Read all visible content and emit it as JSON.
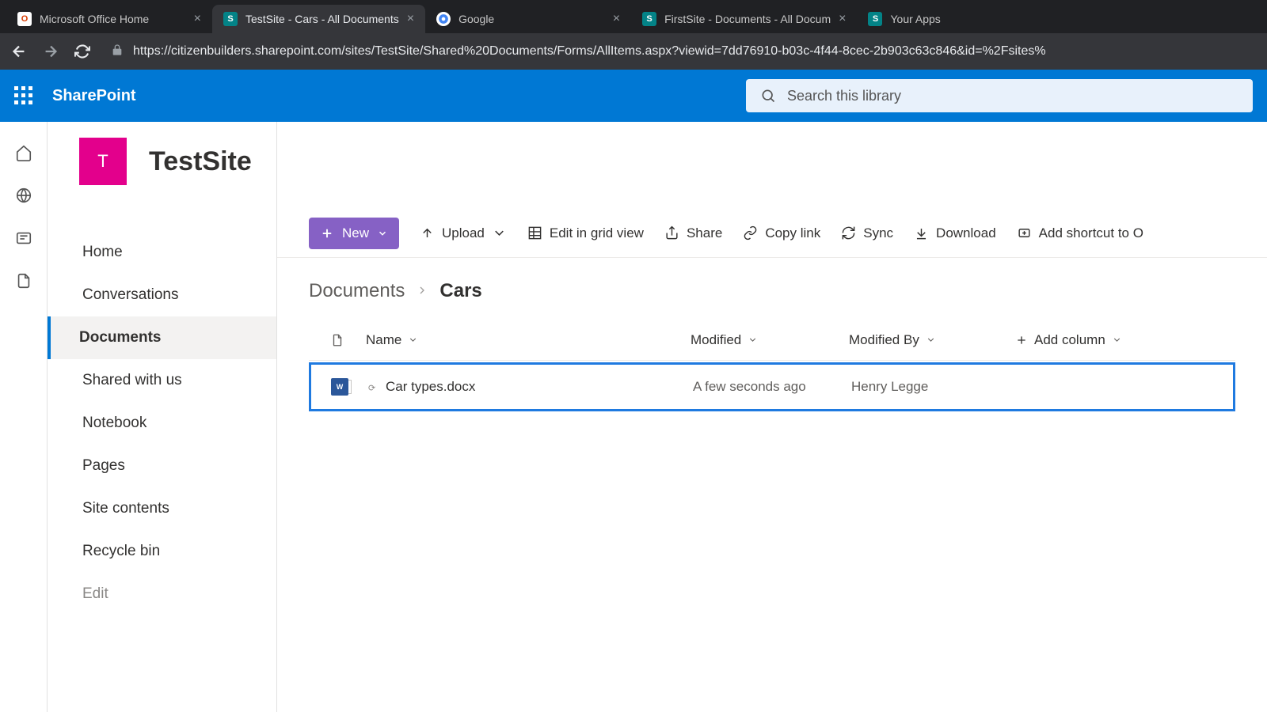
{
  "browser": {
    "tabs": [
      {
        "label": "Microsoft Office Home",
        "favicon": "office"
      },
      {
        "label": "TestSite - Cars - All Documents",
        "favicon": "sp",
        "active": true
      },
      {
        "label": "Google",
        "favicon": "google"
      },
      {
        "label": "FirstSite - Documents - All Docum",
        "favicon": "sp"
      },
      {
        "label": "Your Apps",
        "favicon": "sp"
      }
    ],
    "url": "https://citizenbuilders.sharepoint.com/sites/TestSite/Shared%20Documents/Forms/AllItems.aspx?viewid=7dd76910-b03c-4f44-8cec-2b903c63c846&id=%2Fsites%"
  },
  "suite": {
    "brand": "SharePoint",
    "search_placeholder": "Search this library"
  },
  "site": {
    "logo_letter": "T",
    "title": "TestSite"
  },
  "nav": {
    "items": [
      "Home",
      "Conversations",
      "Documents",
      "Shared with us",
      "Notebook",
      "Pages",
      "Site contents",
      "Recycle bin"
    ],
    "edit": "Edit",
    "active_index": 2
  },
  "commands": {
    "new": "New",
    "upload": "Upload",
    "edit_grid": "Edit in grid view",
    "share": "Share",
    "copy_link": "Copy link",
    "sync": "Sync",
    "download": "Download",
    "add_shortcut": "Add shortcut to O"
  },
  "breadcrumb": {
    "root": "Documents",
    "current": "Cars"
  },
  "table": {
    "columns": {
      "name": "Name",
      "modified": "Modified",
      "modified_by": "Modified By",
      "add": "Add column"
    },
    "rows": [
      {
        "name": "Car types.docx",
        "modified": "A few seconds ago",
        "modified_by": "Henry Legge",
        "type": "word"
      }
    ]
  }
}
